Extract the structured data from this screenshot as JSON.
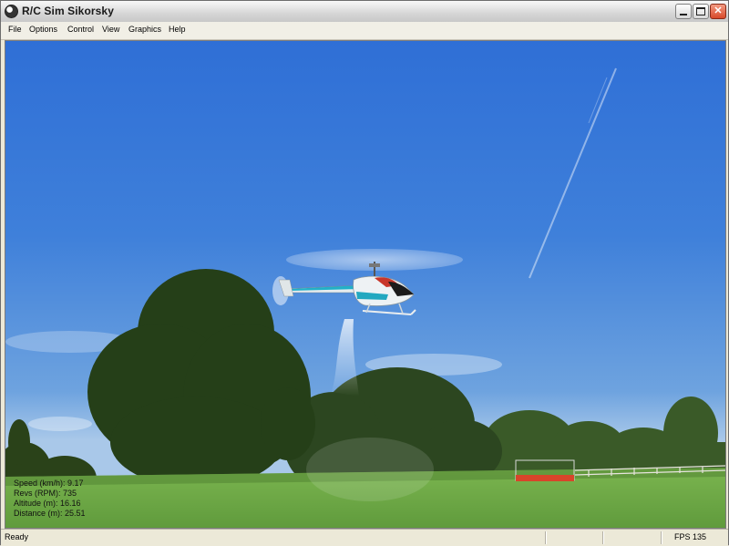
{
  "window": {
    "title": "R/C Sim Sikorsky"
  },
  "menu": {
    "items": [
      "File",
      "Options",
      "Control",
      "View",
      "Graphics",
      "Help"
    ]
  },
  "hud": {
    "speed": "Speed (km/h): 9.17",
    "revs": "Revs (RPM): 735",
    "altitude": "Altitude (m): 16.16",
    "distance": "Distance (m): 25.51"
  },
  "status": {
    "left": "Ready",
    "fps": "FPS 135"
  },
  "colors": {
    "sky": "#3f80da",
    "grass": "#6fa548",
    "trees": "#2f4a1e",
    "heli_body": "#e9eef0",
    "heli_stripe": "#20b0c8",
    "heli_accent": "#c8362a"
  }
}
